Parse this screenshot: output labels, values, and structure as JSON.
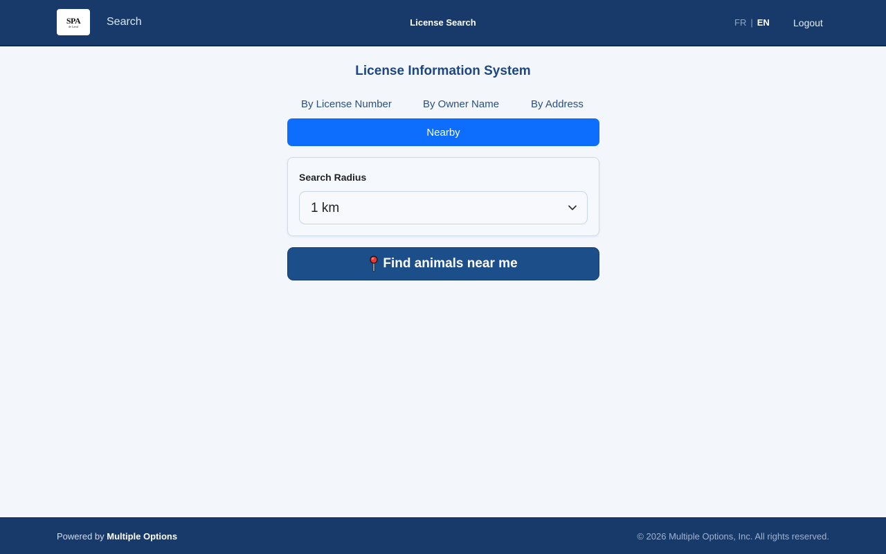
{
  "header": {
    "logo_text": "SPA",
    "logo_sub": "de Laval",
    "search_link": "Search",
    "title": "License Search",
    "lang_fr": "FR",
    "lang_sep": "|",
    "lang_en": "EN",
    "logout": "Logout"
  },
  "main": {
    "page_title": "License Information System",
    "tabs": [
      {
        "label": "By License Number"
      },
      {
        "label": "By Owner Name"
      },
      {
        "label": "By Address"
      },
      {
        "label": "Nearby"
      }
    ],
    "active_tab": "Nearby",
    "radius_label": "Search Radius",
    "radius_value": "1 km",
    "find_button": "Find animals near me",
    "find_icon": "map-pin-icon"
  },
  "footer": {
    "powered_prefix": "Powered by",
    "powered_brand": "Multiple Options",
    "copyright": "© 2026 Multiple Options, Inc. All rights reserved."
  },
  "colors": {
    "header_bg": "#173a6b",
    "active_tab": "#0d6efd",
    "button_bg": "#1c4f8a",
    "title": "#1e4680"
  }
}
